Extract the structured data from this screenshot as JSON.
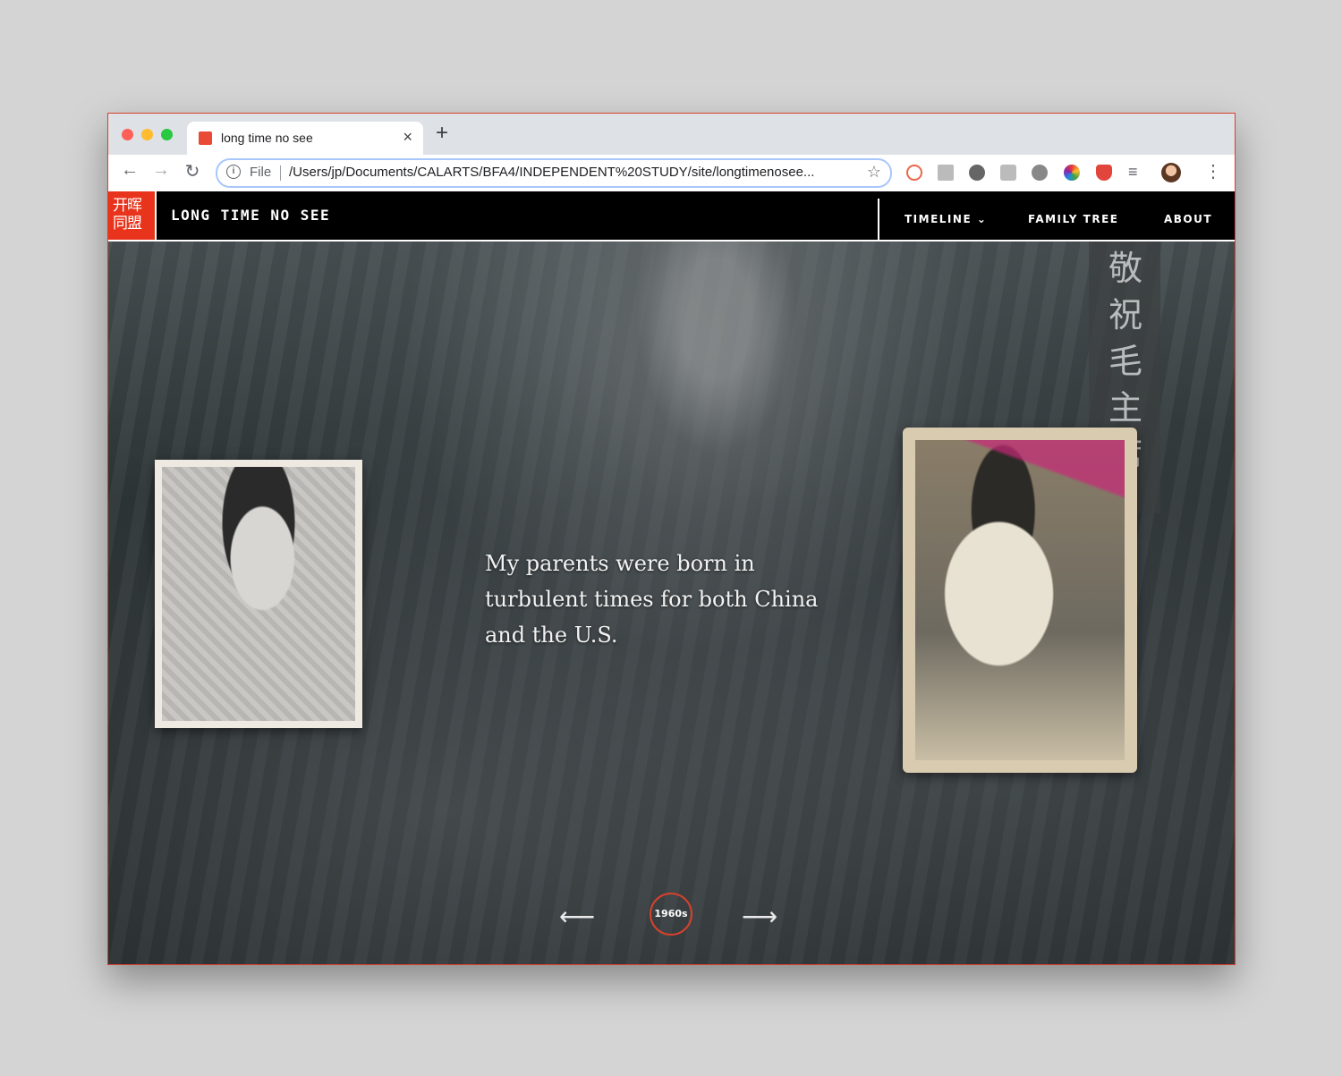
{
  "browser": {
    "tab_title": "long time no see",
    "tab_close_icon": "×",
    "new_tab_icon": "+",
    "address_prefix": "File",
    "url": "/Users/jp/Documents/CALARTS/BFA4/INDEPENDENT%20STUDY/site/longtimenosee...",
    "back_icon": "←",
    "forward_icon": "→",
    "reload_icon": "↻",
    "info_icon": "i",
    "bookmark_icon": "☆",
    "queue_icon": "≡",
    "menu_icon": "⋮"
  },
  "site": {
    "logo_text": "开晖同盟",
    "title": "LONG TIME NO SEE",
    "nav": {
      "timeline": "TIMELINE ⌄",
      "family_tree": "FAMILY TREE",
      "about": "ABOUT"
    }
  },
  "hero": {
    "text": "My parents were born in turbulent times for both China and the U.S.",
    "banner_text": "敬祝毛主席",
    "era": "1960s",
    "prev_arrow": "⟵",
    "next_arrow": "⟶"
  },
  "colors": {
    "accent": "#e8341c",
    "window_border": "#d9412c"
  }
}
